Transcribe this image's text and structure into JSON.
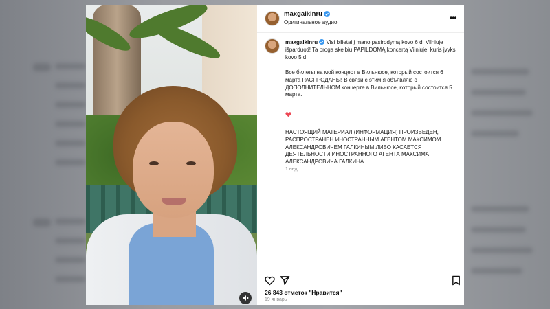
{
  "post": {
    "username": "maxgalkinru",
    "audio_label": "Оригинальное аудио",
    "more_icon": "more-dots-icon",
    "caption_lt": "Visi bilietai į mano pasirodymą kovo 6 d. Vilniuje išparduoti! Ta proga skelbiu PAPILDOMĄ koncertą Vilniuje, kuris įvyks kovo 5 d.",
    "caption_ru": "Все билеты на мой концерт в Вильнюсе, который состоится 6 марта РАСПРОДАНЫ! В связи с этим я объявляю о ДОПОЛНИТЕЛЬНОМ концерте в Вильнюсе, который состоится 5 марта.",
    "notice": "НАСТОЯЩИЙ МАТЕРИАЛ (ИНФОРМАЦИЯ) ПРОИЗВЕДЕН, РАСПРОСТРАНЁН ИНОСТРАННЫМ АГЕНТОМ МАКСИМОМ АЛЕКСАНДРОВИЧЕМ ГАЛКИНЫМ ЛИБО КАСАЕТСЯ ДЕЯТЕЛЬНОСТИ ИНОСТРАННОГО АГЕНТА МАКСИМА АЛЕКСАНДРОВИЧА ГАЛКИНА",
    "time_ago": "1 нед.",
    "likes": "26 843 отметок \"Нравится\"",
    "date": "19 январь"
  },
  "colors": {
    "verified": "#3897f0",
    "heart": "#ed4956"
  }
}
